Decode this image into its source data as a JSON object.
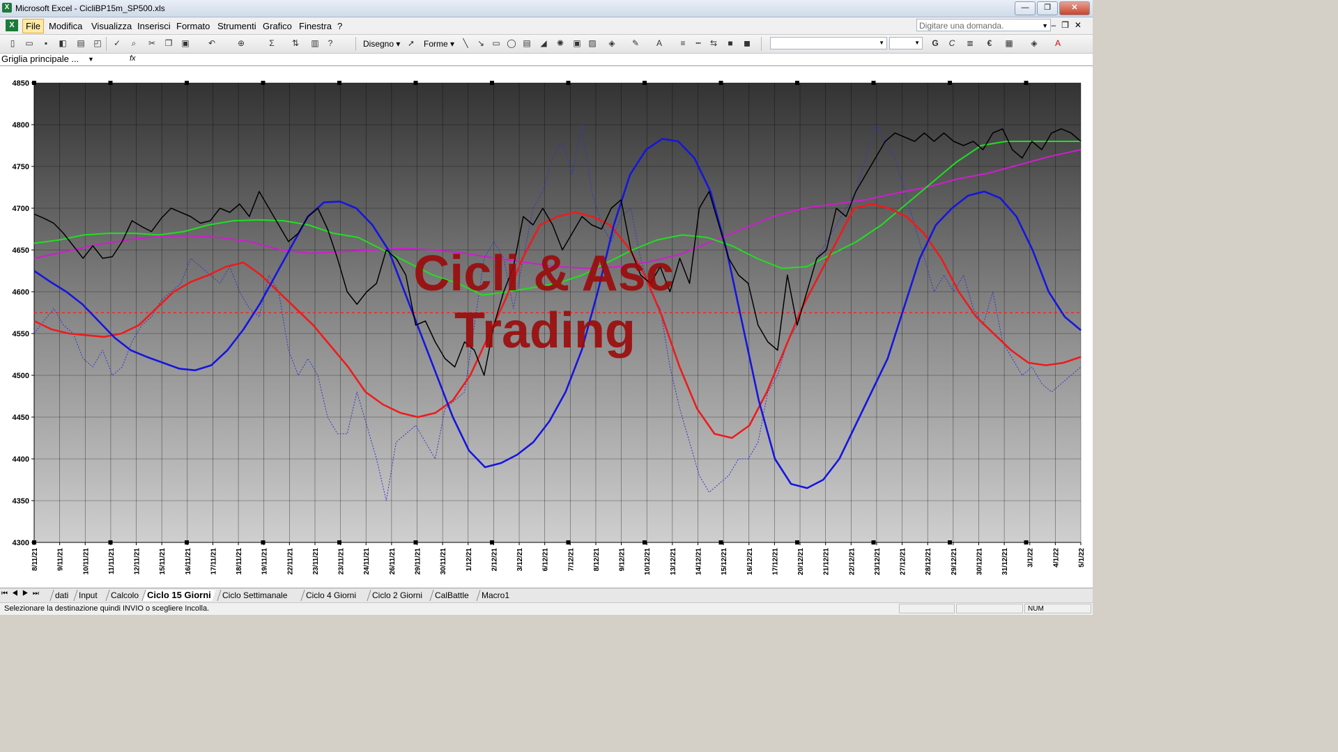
{
  "window": {
    "app_icon": "X",
    "title": "Microsoft Excel - CicliBP15m_SP500.xls",
    "buttons": [
      "—",
      "❐",
      "✕"
    ]
  },
  "menubar": {
    "items": [
      "File",
      "Modifica",
      "Visualizza",
      "Inserisci",
      "Formato",
      "Strumenti",
      "Grafico",
      "Finestra",
      "?"
    ],
    "help_placeholder": "Digitare una domanda.",
    "doc_controls": "–❐✕"
  },
  "toolbar": {
    "disegno": "Disegno ▾",
    "forme": "Forme ▾"
  },
  "formula_bar": {
    "name_box": "Griglia principale ...",
    "fx": "fx"
  },
  "watermark": {
    "line1": "Cicli & Asc",
    "line2": "Trading"
  },
  "sheet_tabs": [
    "dati",
    "Input",
    "Calcolo",
    "Ciclo 15 Giorni",
    "Ciclo Settimanale",
    "Ciclo 4 Giorni",
    "Ciclo 2 Giorni",
    "CalBattle",
    "Macro1"
  ],
  "active_tab": "Ciclo 15 Giorni",
  "status": {
    "message": "Selezionare la destinazione quindi INVIO o scegliere Incolla.",
    "num": "NUM"
  },
  "colors": {
    "price": "#000000",
    "blue_cycle": "#1515e0",
    "red_cycle": "#ee1b1b",
    "green_ma": "#1fe01f",
    "magenta_ma": "#d01cd0",
    "dotted": "#3333cc",
    "ref_line": "#ff2020",
    "watermark": "#9b0a0a"
  },
  "chart_data": {
    "type": "line",
    "ylim": [
      4300,
      4850
    ],
    "y_ticks": [
      4300,
      4350,
      4400,
      4450,
      4500,
      4550,
      4600,
      4650,
      4700,
      4750,
      4800,
      4850
    ],
    "x_labels": [
      "8/11/21",
      "9/11/21",
      "10/11/21",
      "11/11/21",
      "12/11/21",
      "15/11/21",
      "16/11/21",
      "17/11/21",
      "18/11/21",
      "19/11/21",
      "22/11/21",
      "23/11/21",
      "23/11/21",
      "24/11/21",
      "26/11/21",
      "29/11/21",
      "30/11/21",
      "1/12/21",
      "2/12/21",
      "3/12/21",
      "6/12/21",
      "7/12/21",
      "8/12/21",
      "9/12/21",
      "10/12/21",
      "13/12/21",
      "14/12/21",
      "15/12/21",
      "16/12/21",
      "17/12/21",
      "20/12/21",
      "21/12/21",
      "22/12/21",
      "23/12/21",
      "27/12/21",
      "28/12/21",
      "29/12/21",
      "30/12/21",
      "31/12/21",
      "3/1/22",
      "4/1/22",
      "5/1/22"
    ],
    "reference_line": 4575,
    "series": [
      {
        "key": "price",
        "values": [
          4693,
          4688,
          4682,
          4670,
          4655,
          4640,
          4655,
          4640,
          4642,
          4660,
          4685,
          4678,
          4672,
          4688,
          4700,
          4695,
          4690,
          4682,
          4685,
          4700,
          4695,
          4705,
          4690,
          4720,
          4700,
          4680,
          4660,
          4670,
          4690,
          4700,
          4675,
          4640,
          4600,
          4585,
          4600,
          4610,
          4650,
          4640,
          4620,
          4560,
          4565,
          4540,
          4520,
          4510,
          4540,
          4530,
          4500,
          4560,
          4600,
          4630,
          4690,
          4680,
          4700,
          4680,
          4650,
          4670,
          4690,
          4680,
          4675,
          4700,
          4710,
          4650,
          4620,
          4610,
          4630,
          4600,
          4640,
          4610,
          4700,
          4720,
          4680,
          4640,
          4620,
          4610,
          4560,
          4540,
          4530,
          4620,
          4560,
          4600,
          4640,
          4650,
          4700,
          4690,
          4720,
          4740,
          4760,
          4780,
          4790,
          4785,
          4780,
          4790,
          4780,
          4790,
          4780,
          4775,
          4780,
          4770,
          4790,
          4795,
          4770,
          4760,
          4780,
          4770,
          4790,
          4795,
          4790,
          4780
        ]
      },
      {
        "key": "dotted",
        "values": [
          4550,
          4565,
          4580,
          4560,
          4550,
          4520,
          4510,
          4530,
          4500,
          4510,
          4540,
          4560,
          4570,
          4590,
          4600,
          4610,
          4640,
          4630,
          4620,
          4610,
          4630,
          4600,
          4580,
          4570,
          4620,
          4600,
          4530,
          4500,
          4520,
          4500,
          4450,
          4430,
          4430,
          4480,
          4440,
          4400,
          4350,
          4420,
          4430,
          4440,
          4420,
          4400,
          4460,
          4470,
          4480,
          4560,
          4640,
          4660,
          4640,
          4580,
          4640,
          4700,
          4720,
          4760,
          4780,
          4740,
          4800,
          4720,
          4680,
          4660,
          4690,
          4700,
          4640,
          4600,
          4580,
          4510,
          4460,
          4420,
          4380,
          4360,
          4370,
          4380,
          4400,
          4400,
          4420,
          4480,
          4500,
          4540,
          4560,
          4600,
          4640,
          4660,
          4680,
          4700,
          4720,
          4760,
          4800,
          4780,
          4760,
          4720,
          4680,
          4640,
          4600,
          4620,
          4600,
          4620,
          4580,
          4560,
          4600,
          4540,
          4520,
          4500,
          4510,
          4490,
          4480,
          4490,
          4500,
          4510
        ]
      },
      {
        "key": "blue_cycle",
        "values": [
          4625,
          4612,
          4600,
          4585,
          4565,
          4545,
          4530,
          4522,
          4515,
          4508,
          4506,
          4512,
          4530,
          4555,
          4585,
          4620,
          4655,
          4690,
          4707,
          4708,
          4700,
          4680,
          4650,
          4600,
          4550,
          4500,
          4450,
          4410,
          4390,
          4395,
          4405,
          4420,
          4445,
          4480,
          4530,
          4600,
          4680,
          4740,
          4770,
          4783,
          4780,
          4760,
          4720,
          4650,
          4560,
          4470,
          4400,
          4370,
          4365,
          4375,
          4400,
          4440,
          4480,
          4520,
          4580,
          4640,
          4680,
          4700,
          4715,
          4720,
          4712,
          4690,
          4650,
          4600,
          4570,
          4554
        ]
      },
      {
        "key": "red_cycle",
        "values": [
          4565,
          4555,
          4550,
          4548,
          4546,
          4550,
          4560,
          4580,
          4600,
          4612,
          4620,
          4630,
          4635,
          4620,
          4600,
          4580,
          4560,
          4535,
          4510,
          4480,
          4465,
          4455,
          4450,
          4455,
          4470,
          4500,
          4545,
          4590,
          4640,
          4680,
          4690,
          4695,
          4690,
          4680,
          4655,
          4620,
          4570,
          4510,
          4460,
          4430,
          4425,
          4440,
          4480,
          4530,
          4580,
          4620,
          4660,
          4700,
          4705,
          4700,
          4690,
          4670,
          4640,
          4600,
          4570,
          4550,
          4530,
          4515,
          4512,
          4515,
          4522
        ]
      },
      {
        "key": "green_ma",
        "values": [
          4658,
          4662,
          4668,
          4670,
          4670,
          4668,
          4672,
          4680,
          4685,
          4686,
          4685,
          4680,
          4670,
          4665,
          4650,
          4635,
          4620,
          4610,
          4596,
          4600,
          4605,
          4610,
          4620,
          4635,
          4650,
          4662,
          4668,
          4665,
          4655,
          4640,
          4628,
          4630,
          4645,
          4660,
          4680,
          4705,
          4730,
          4755,
          4775,
          4780,
          4780,
          4780,
          4780
        ]
      },
      {
        "key": "magenta_ma",
        "values": [
          4640,
          4648,
          4656,
          4662,
          4666,
          4667,
          4665,
          4660,
          4650,
          4646,
          4648,
          4650,
          4652,
          4650,
          4646,
          4640,
          4635,
          4630,
          4628,
          4630,
          4636,
          4645,
          4660,
          4675,
          4690,
          4700,
          4705,
          4710,
          4718,
          4725,
          4735,
          4742,
          4752,
          4762,
          4770
        ]
      }
    ]
  }
}
